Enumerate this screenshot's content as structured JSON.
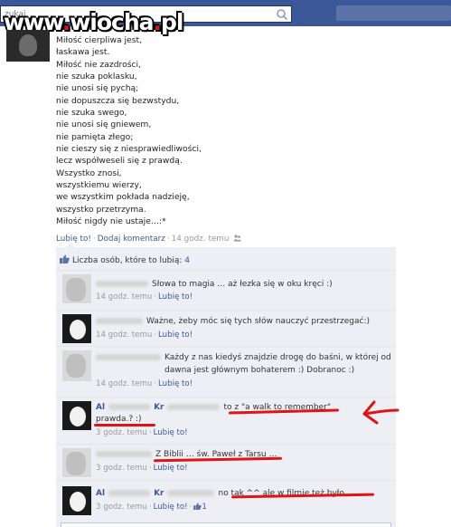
{
  "watermark": {
    "text_a": "www",
    "text_dot": ".",
    "text_b": "wiocha",
    "text_dot2": ".",
    "text_c": "pl"
  },
  "header": {
    "search_placeholder": "zukaj"
  },
  "post": {
    "lines": [
      "Miłość cierpliwa jest,",
      "łaskawa jest.",
      "Miłość nie zazdrości,",
      "nie szuka poklasku,",
      "nie unosi się pychą;",
      "nie dopuszcza się bezwstydu,",
      "nie szuka swego,",
      "nie unosi się gniewem,",
      "nie pamięta złego;",
      "nie cieszy się z niesprawiedliwości,",
      "lecz współweseli się z prawdą.",
      "Wszystko znosi,",
      "wszystkiemu wierzy,",
      "we wszystkim pokłada nadzieję,",
      "wszystko przetrzyma.",
      "Miłość nigdy nie ustaje…:*"
    ],
    "like_label": "Lubię to!",
    "comment_label": "Dodaj komentarz",
    "time": "14 godz. temu"
  },
  "likes": {
    "label": "Liczba osób, które to lubią:",
    "count": "4"
  },
  "comments": [
    {
      "author": "",
      "text": "Słowa to magia … aż łezka się w oku kręci :)",
      "time": "14 godz. temu",
      "like_label": "Lubię to!"
    },
    {
      "author": "",
      "text": "Ważne, żeby móc się tych słów nauczyć przestrzegać:)",
      "time": "14 godz. temu",
      "like_label": "Lubię to!"
    },
    {
      "author": "",
      "text": "Każdy z nas kiedyś znajdzie drogę do baśni, w której od",
      "text2": "dawna jest głównym bohaterem :) Dobranoc :)",
      "time": "14 godz. temu",
      "like_label": "Lubię to!"
    },
    {
      "author": "Al",
      "author2": "Kr",
      "text": "to z \"a walk to remember\"",
      "text2": "prawda.? :)",
      "time": "3 godz. temu",
      "like_label": "Lubię to!"
    },
    {
      "author": "",
      "text": "Z Biblii … św. Paweł z Tarsu …",
      "time": "3 godz. temu",
      "like_label": "Lubię to!"
    },
    {
      "author": "Al",
      "author2": "Kr",
      "text": "no tak ^^ ale w filmie też było",
      "time": "3 godz. temu",
      "like_label": "Lubię to!",
      "like_count": "1"
    }
  ],
  "colors": {
    "facebook_blue": "#3b5998",
    "annotation_red": "#e01414",
    "comment_bg": "#edeff4"
  }
}
